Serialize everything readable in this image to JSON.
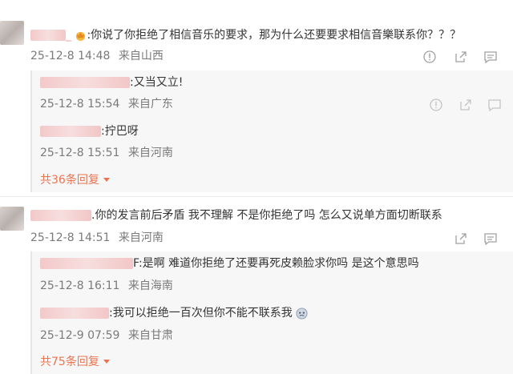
{
  "comments": [
    {
      "text": ":你说了你拒绝了相信音乐的要求，那为什么还要要求相信音樂联系你？？？",
      "date": "25-12-8 14:48",
      "location": "来自山西",
      "replies": [
        {
          "text": ":又当又立!",
          "date": "25-12-8 15:54",
          "location": "来自广东"
        },
        {
          "text": ":拧巴呀",
          "date": "25-12-8 15:51",
          "location": "来自河南"
        }
      ],
      "more_replies": "共36条回复"
    },
    {
      "text": ".你的发言前后矛盾  我不理解  不是你拒绝了吗  怎么又说单方面切断联系",
      "date": "25-12-8 14:51",
      "location": "来自河南",
      "replies": [
        {
          "text": "F:是啊 难道你拒绝了还要再死皮赖脸求你吗 是这个意思吗",
          "date": "25-12-8 16:11",
          "location": "来自海南"
        },
        {
          "text": ":我可以拒绝一百次但你不能不联系我",
          "date": "25-12-9 07:59",
          "location": "来自甘肃"
        }
      ],
      "more_replies": "共75条回复"
    }
  ],
  "icons": {
    "report": "report-icon",
    "share": "share-icon",
    "comment": "comment-icon",
    "chevron": "chevron-down-icon"
  },
  "colors": {
    "more_link": "#eb7350",
    "meta": "#7a7a7a"
  }
}
